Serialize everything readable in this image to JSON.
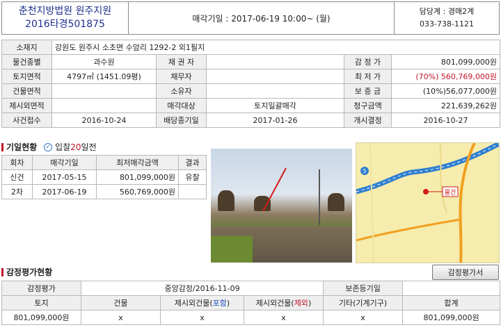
{
  "header": {
    "court": "춘천지방법원 원주지원",
    "case_no": "2016타경501875",
    "sale_date": "매각기일 : 2017-06-19   10:00~ (월)",
    "dept": "담당계 : 경매2계",
    "phone": "033-738-1121"
  },
  "info": {
    "address_label": "소재지",
    "address": "강원도 원주시 소초면 수암리 1292-2 외1필지",
    "rows": [
      {
        "l1": "물건종별",
        "v1": "과수원",
        "l2": "채 권 자",
        "v2": "",
        "l3": "감 정 가",
        "v3": "801,099,000원"
      },
      {
        "l1": "토지면적",
        "v1": "4797㎡ (1451.09평)",
        "l2": "채무자",
        "v2": "",
        "l3": "최 저 가",
        "v3": "(70%) 560,769,000원"
      },
      {
        "l1": "건물면적",
        "v1": "",
        "l2": "소유자",
        "v2": "",
        "l3": "보 증 금",
        "v3": "(10%)56,077,000원"
      },
      {
        "l1": "제시외면적",
        "v1": "",
        "l2": "매각대상",
        "v2": "토지일괄매각",
        "l3": "청구금액",
        "v3": "221,639,262원"
      },
      {
        "l1": "사건접수",
        "v1": "2016-10-24",
        "l2": "배당종기일",
        "v2": "2017-01-26",
        "l3": "개시결정",
        "v3": "2016-10-27"
      }
    ]
  },
  "history": {
    "title": "기일현황",
    "bid_prefix": "입찰",
    "bid_days": "20",
    "bid_suffix": "일전",
    "headers": [
      "회차",
      "매각기일",
      "최저매각금액",
      "결과"
    ],
    "rows": [
      {
        "round": "신건",
        "date": "2017-05-15",
        "price": "801,099,000원",
        "result": "유찰"
      },
      {
        "round": "2차",
        "date": "2017-06-19",
        "price": "560,769,000원",
        "result": ""
      }
    ]
  },
  "map": {
    "marker_label": "물건",
    "route_label": "5",
    "road_color": "#2f7fd0",
    "local_road_color": "#f0a020"
  },
  "appraisal": {
    "title": "감정평가현황",
    "button": "감정평가서",
    "row1": {
      "label": "감정평가",
      "value": "중앙감정/2016-11-09",
      "label2": "보존등기일",
      "value2": ""
    },
    "headers": {
      "land": "토지",
      "building": "건물",
      "incl_prefix": "제시외건물(",
      "incl_word": "포함",
      "excl_prefix": "제시외건물(",
      "excl_word": "제외",
      "suffix": ")",
      "other": "기타(기계기구)",
      "total": "합계"
    },
    "values": [
      "801,099,000원",
      "x",
      "x",
      "x",
      "x",
      "801,099,000원"
    ]
  },
  "colors": {
    "accent_red": "#c0142a",
    "court_blue": "#1f2f8c"
  }
}
